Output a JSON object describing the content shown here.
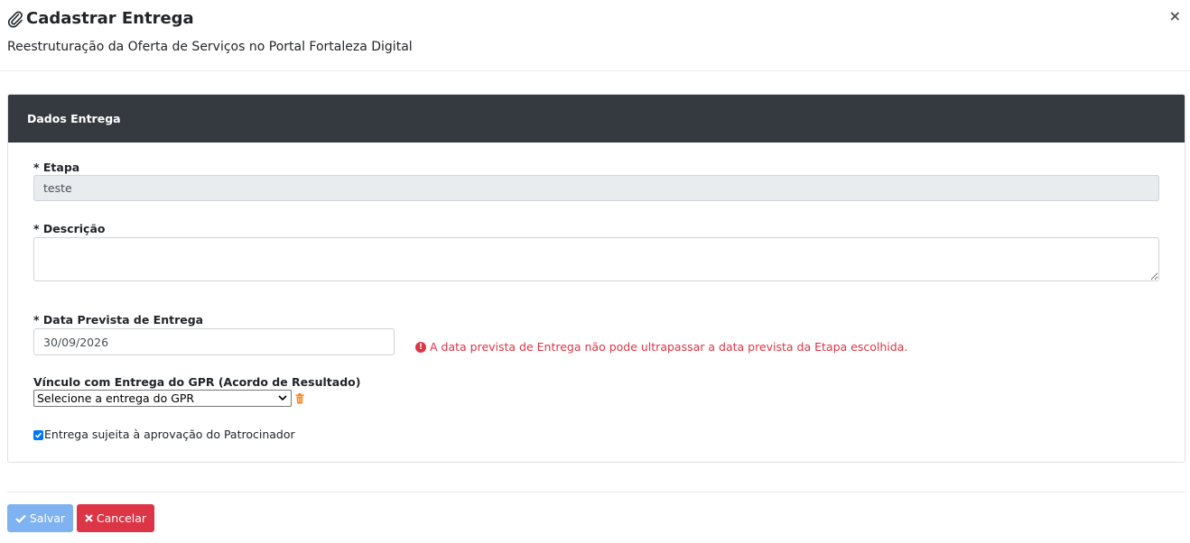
{
  "header": {
    "title": "Cadastrar Entrega",
    "subtitle": "Reestruturação da Oferta de Serviços no Portal Fortaleza Digital",
    "close_label": "×",
    "title_icon": "paperclip-icon"
  },
  "card": {
    "title": "Dados Entrega"
  },
  "form": {
    "etapa": {
      "label": "* Etapa",
      "value": "teste"
    },
    "descricao": {
      "label": "* Descrição",
      "value": ""
    },
    "data_prevista": {
      "label": "* Data Prevista de Entrega",
      "value": "30/09/2026"
    },
    "error_message": "A data prevista de Entrega não pode ultrapassar a data prevista da Etapa escolhida.",
    "vinculo": {
      "label": "Vínculo com Entrega do GPR (Acordo de Resultado)",
      "selected": "Selecione a entrega do GPR"
    },
    "aprovacao": {
      "label": "Entrega sujeita à aprovação do Patrocinador",
      "checked": true
    }
  },
  "footer": {
    "save_label": "Salvar",
    "cancel_label": "Cancelar"
  },
  "colors": {
    "card_header_bg": "#343a40",
    "error": "#dc3545",
    "save_button": "#7fb2f0",
    "cancel_button": "#dc3545",
    "trash_icon": "#fd7e14"
  }
}
